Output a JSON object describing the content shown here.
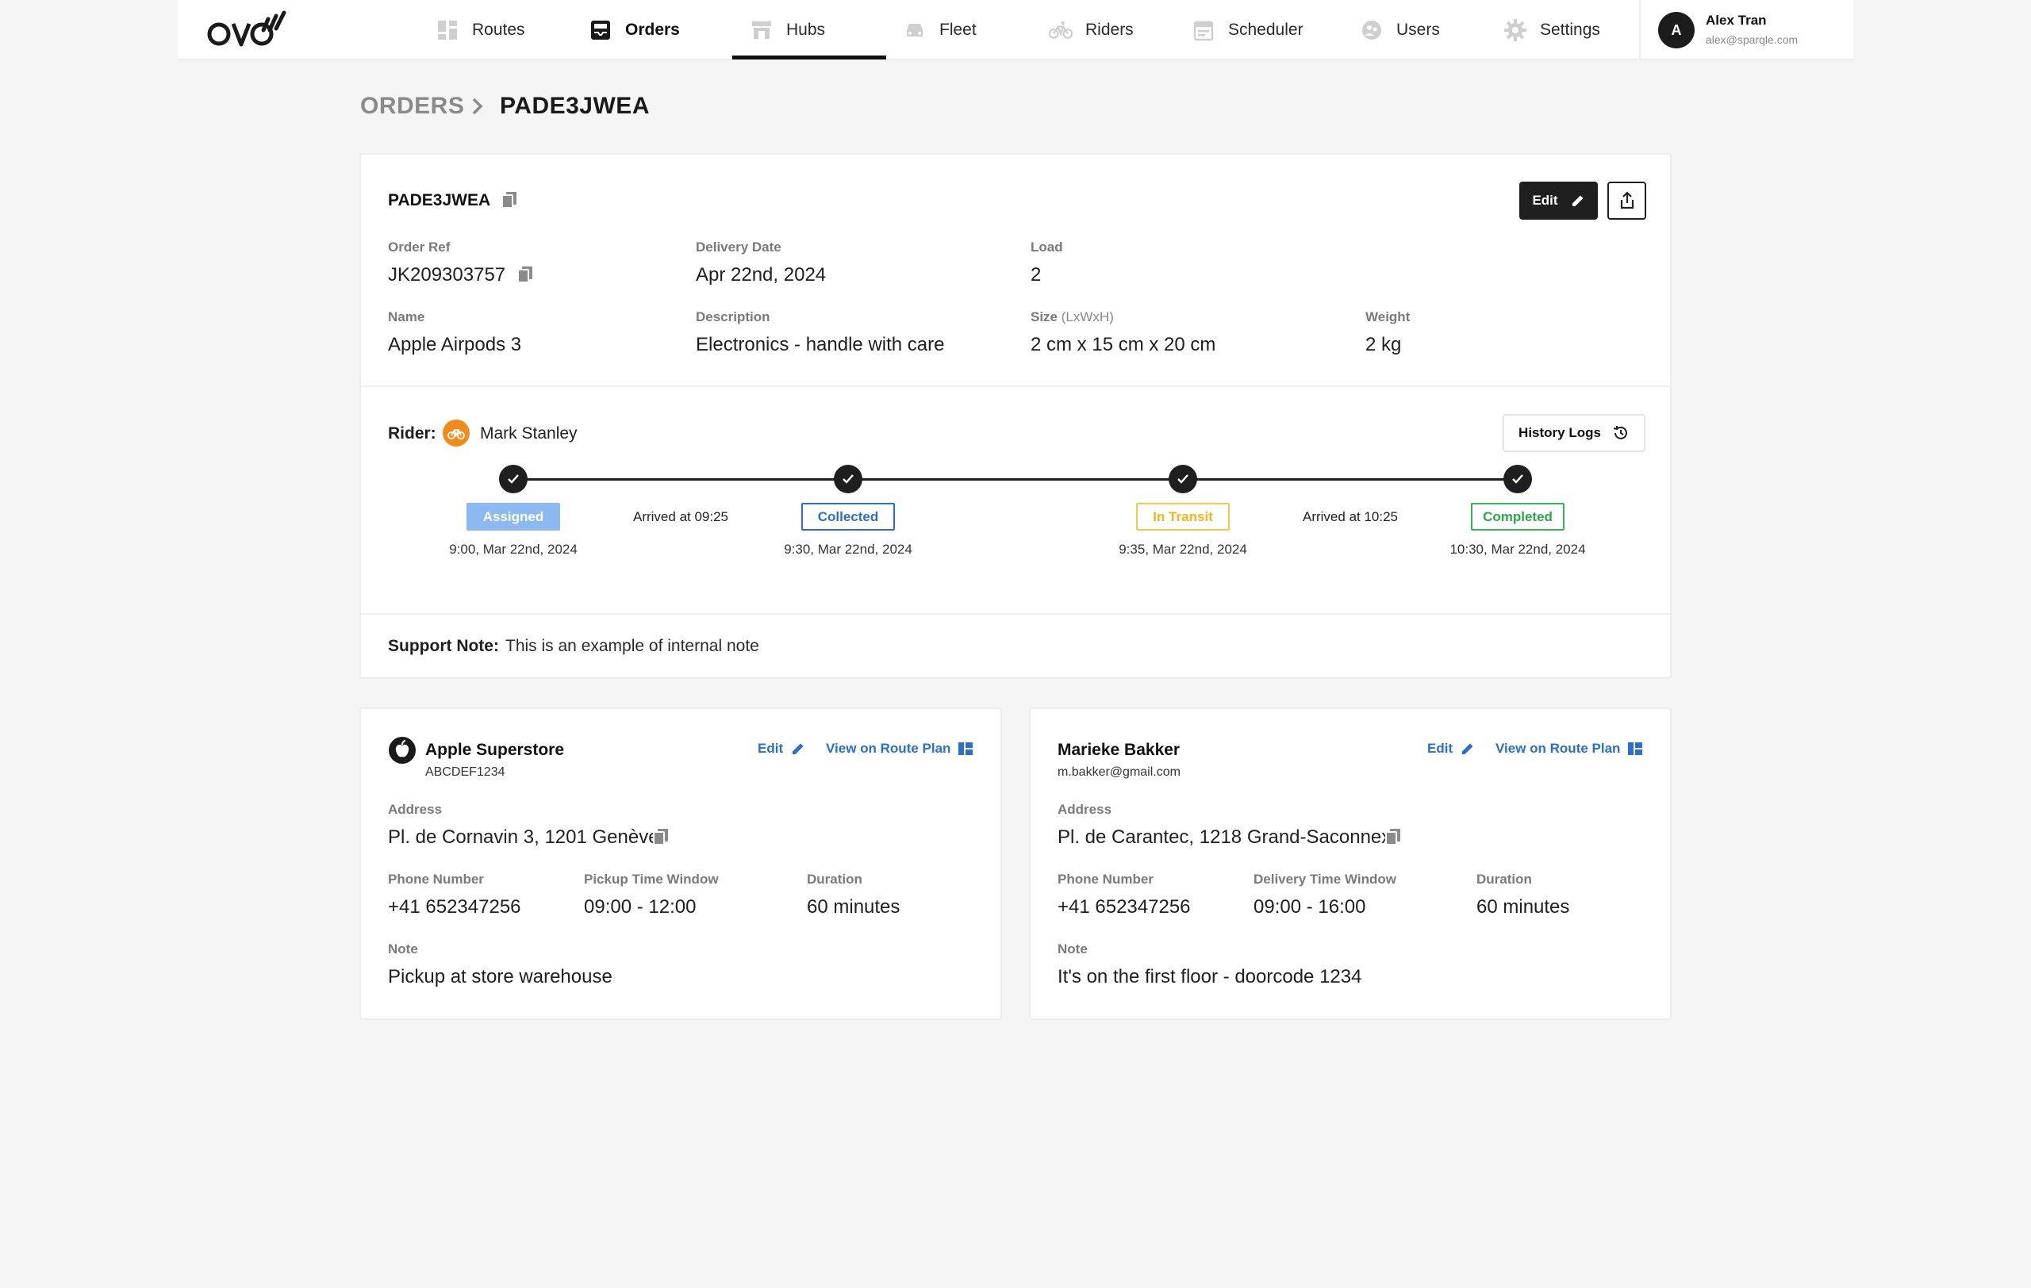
{
  "app": {
    "logo_text": "OVO",
    "nav": [
      {
        "label": "Routes",
        "icon": "routes-icon"
      },
      {
        "label": "Orders",
        "icon": "orders-icon",
        "active": true
      },
      {
        "label": "Hubs",
        "icon": "hubs-icon"
      },
      {
        "label": "Fleet",
        "icon": "fleet-icon"
      },
      {
        "label": "Riders",
        "icon": "bike-icon"
      },
      {
        "label": "Scheduler",
        "icon": "calendar-icon"
      },
      {
        "label": "Users",
        "icon": "users-icon"
      },
      {
        "label": "Settings",
        "icon": "gear-icon"
      }
    ],
    "user": {
      "initial": "A",
      "name": "Alex Tran",
      "email": "alex@sparqle.com"
    }
  },
  "breadcrumb": {
    "root": "ORDERS",
    "current": "PADE3JWEA"
  },
  "order": {
    "id": "PADE3JWEA",
    "edit_label": "Edit",
    "fields": {
      "order_ref": {
        "label": "Order Ref",
        "value": "JK209303757"
      },
      "delivery_date": {
        "label": "Delivery Date",
        "value": "Apr 22nd, 2024"
      },
      "load": {
        "label": "Load",
        "value": "2"
      },
      "name": {
        "label": "Name",
        "value": "Apple Airpods 3"
      },
      "description": {
        "label": "Description",
        "value": "Electronics - handle with care"
      },
      "size": {
        "label": "Size",
        "label_suffix": "(LxWxH)",
        "value": "2 cm x 15 cm x 20 cm"
      },
      "weight": {
        "label": "Weight",
        "value": "2 kg"
      }
    },
    "rider": {
      "label": "Rider:",
      "name": "Mark Stanley"
    },
    "history_label": "History Logs",
    "timeline": [
      {
        "status": "Assigned",
        "time": "9:00, Mar 22nd, 2024"
      },
      {
        "status": "Collected",
        "time": "9:30, Mar 22nd, 2024"
      },
      {
        "status": "In Transit",
        "time": "9:35, Mar 22nd, 2024"
      },
      {
        "status": "Completed",
        "time": "10:30, Mar 22nd, 2024"
      }
    ],
    "arrivals": [
      "Arrived at 09:25",
      "Arrived at 10:25"
    ],
    "support_note": {
      "label": "Support Note:",
      "text": "This is an example of internal note"
    }
  },
  "pickup": {
    "name": "Apple Superstore",
    "sub": "ABCDEF1234",
    "edit_label": "Edit",
    "route_label": "View on Route Plan",
    "address_label": "Address",
    "address": "Pl. de Cornavin 3, 1201 Genève",
    "phone_label": "Phone Number",
    "phone": "+41 652347256",
    "window_label": "Pickup Time Window",
    "window": "09:00 - 12:00",
    "duration_label": "Duration",
    "duration": "60 minutes",
    "note_label": "Note",
    "note": "Pickup at store warehouse"
  },
  "dropoff": {
    "name": "Marieke Bakker",
    "sub": "m.bakker@gmail.com",
    "edit_label": "Edit",
    "route_label": "View on Route Plan",
    "address_label": "Address",
    "address": "Pl. de Carantec, 1218 Grand-Saconnex",
    "phone_label": "Phone Number",
    "phone": "+41 652347256",
    "window_label": "Delivery Time Window",
    "window": "09:00 - 16:00",
    "duration_label": "Duration",
    "duration": "60 minutes",
    "note_label": "Note",
    "note": "It's on the first floor - doorcode 1234"
  },
  "colors": {
    "accent": "#2a6ed0",
    "rider": "#f28b1c",
    "assigned": "#8db9f2",
    "transit": "#f2b51c",
    "completed": "#2aa84a"
  }
}
